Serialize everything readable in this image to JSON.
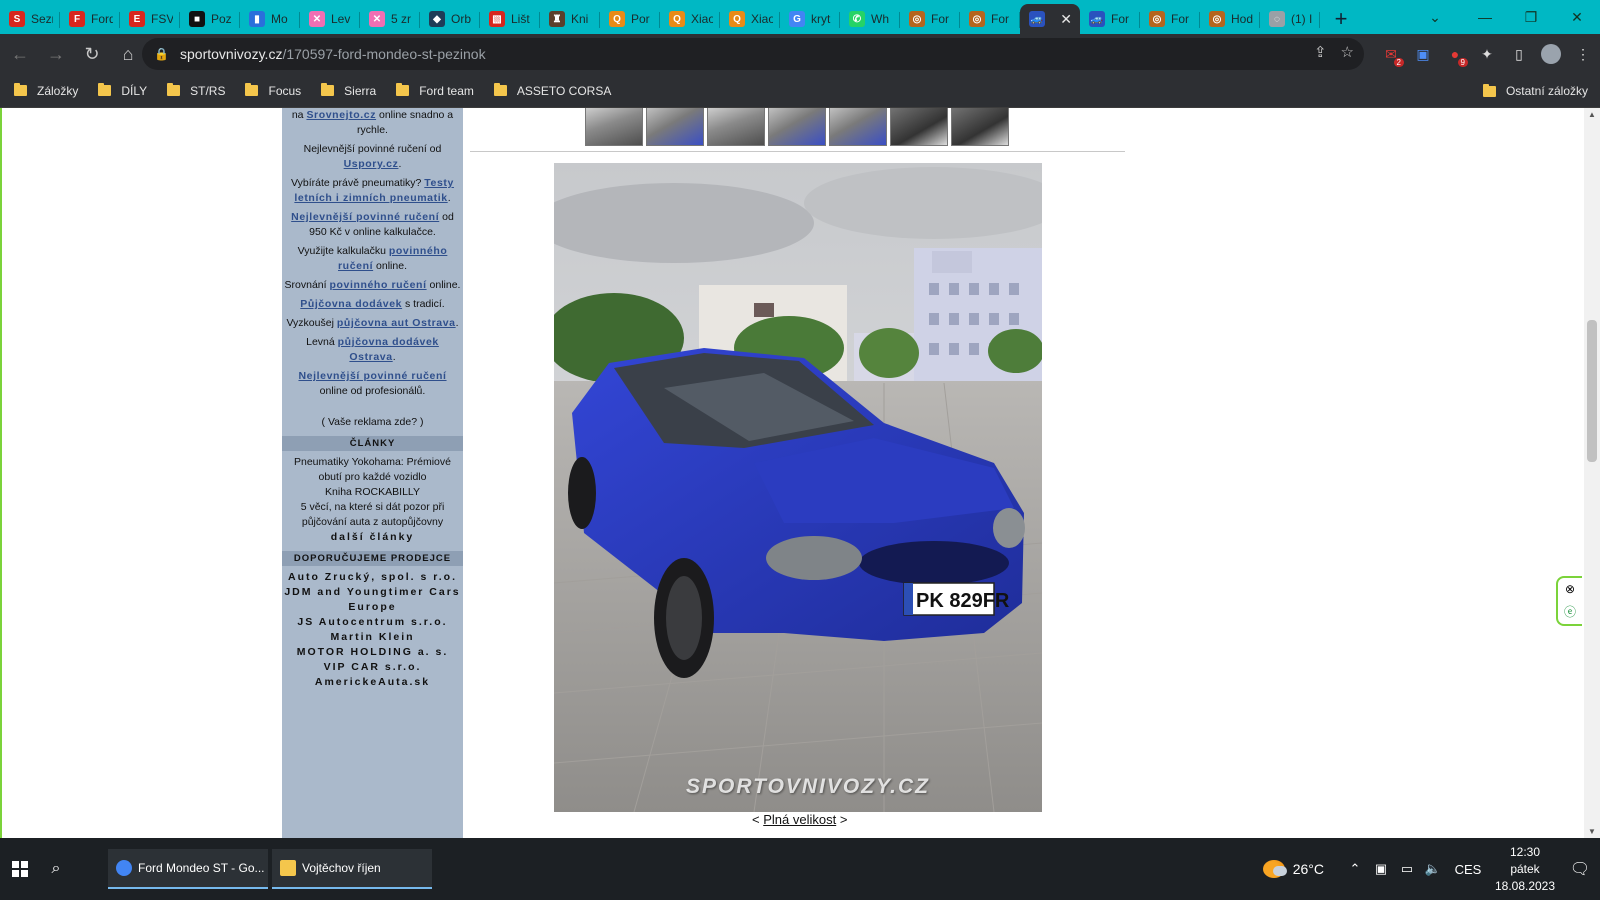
{
  "browser": {
    "tabs": [
      {
        "title": "Sezr",
        "icon": "seznam-icon",
        "color": "#d7261e",
        "glyph": "S"
      },
      {
        "title": "Ford",
        "icon": "ford-forum-icon",
        "color": "#d7261e",
        "glyph": "F"
      },
      {
        "title": "FSV",
        "icon": "fsv-icon",
        "color": "#d7261e",
        "glyph": "E"
      },
      {
        "title": "Poz",
        "icon": "poz-icon",
        "color": "#111111",
        "glyph": "■"
      },
      {
        "title": "Mo",
        "icon": "mo-icon",
        "color": "#2a6fdb",
        "glyph": "▮"
      },
      {
        "title": "Lev",
        "icon": "lev-icon",
        "color": "#f06fb3",
        "glyph": "✕"
      },
      {
        "title": "5 zr",
        "icon": "5zr-icon",
        "color": "#f06fb3",
        "glyph": "✕"
      },
      {
        "title": "Orb",
        "icon": "orb-icon",
        "color": "#1f3d57",
        "glyph": "◆"
      },
      {
        "title": "Lišt",
        "icon": "list-icon",
        "color": "#d7261e",
        "glyph": "▧"
      },
      {
        "title": "Kni",
        "icon": "kniha-icon",
        "color": "#5b3f2b",
        "glyph": "♜"
      },
      {
        "title": "Por",
        "icon": "search-tab-icon",
        "color": "#e88b16",
        "glyph": "Q"
      },
      {
        "title": "Xiao",
        "icon": "search-tab-icon",
        "color": "#e88b16",
        "glyph": "Q"
      },
      {
        "title": "Xiao",
        "icon": "search-tab-icon",
        "color": "#e88b16",
        "glyph": "Q"
      },
      {
        "title": "kryt",
        "icon": "google-icon",
        "color": "#4285f4",
        "glyph": "G"
      },
      {
        "title": "Wh",
        "icon": "whatsapp-icon",
        "color": "#25d366",
        "glyph": "✆"
      },
      {
        "title": "For",
        "icon": "ford-club-icon",
        "color": "#b5651d",
        "glyph": "◎"
      },
      {
        "title": "For",
        "icon": "ford-club-icon",
        "color": "#b5651d",
        "glyph": "◎"
      },
      {
        "title": "",
        "icon": "sportovnivozy-icon",
        "color": "#2a52be",
        "glyph": "🚙",
        "active": true
      },
      {
        "title": "For",
        "icon": "sportovnivozy-icon",
        "color": "#2a52be",
        "glyph": "🚙"
      },
      {
        "title": "For",
        "icon": "ford-club-icon",
        "color": "#b5651d",
        "glyph": "◎"
      },
      {
        "title": "Hod",
        "icon": "ford-club-icon",
        "color": "#b5651d",
        "glyph": "◎"
      },
      {
        "title": "(1) I",
        "icon": "loading-icon",
        "color": "#9aa0a6",
        "glyph": "◌"
      }
    ],
    "new_tab_label": "+",
    "url_host": "sportovnivozy.cz",
    "url_path": "/170597-ford-mondeo-st-pezinok",
    "extension_badges": {
      "mail": "2",
      "ublock": "9"
    },
    "bookmarks": [
      "Záložky",
      "DÍLY",
      "ST/RS",
      "Focus",
      "Sierra",
      "Ford team",
      "ASSETO CORSA"
    ],
    "other_bookmarks": "Ostatní záložky"
  },
  "sidebar": {
    "ads": [
      {
        "pre": "na ",
        "link": "Srovnejto.cz",
        "post": " online snadno a rychle."
      },
      {
        "pre": "Nejlevnější povinné ručení od ",
        "link": "Uspory.cz",
        "post": "."
      },
      {
        "pre": "Vybíráte právě pneumatiky? ",
        "link": "Testy letních i zimních pneumatik",
        "post": "."
      },
      {
        "pre": "",
        "link": "Nejlevnější povinné ručení",
        "post": " od 950 Kč v online kalkulačce."
      },
      {
        "pre": "Využijte kalkulačku ",
        "link": "povinného ručení",
        "post": " online."
      },
      {
        "pre": "Srovnání ",
        "link": "povinného ručení",
        "post": " online."
      },
      {
        "pre": "",
        "link": "Půjčovna dodávek",
        "post": " s tradicí."
      },
      {
        "pre": "Vyzkoušej ",
        "link": "půjčovna aut Ostrava",
        "post": "."
      },
      {
        "pre": "Levná ",
        "link": "půjčovna dodávek Ostrava",
        "post": "."
      },
      {
        "pre": "",
        "link": "Nejlevnější povinné ručení",
        "post": " online od profesionálů."
      }
    ],
    "ad_cta": "( Vaše reklama zde? )",
    "articles_heading": "ČLÁNKY",
    "articles": [
      "Pneumatiky Yokohama: Prémiové obutí pro každé vozidlo",
      "Kniha ROCKABILLY",
      "5 věcí, na které si dát pozor při půjčování auta z autopůjčovny"
    ],
    "more_articles": "další články",
    "dealers_heading": "DOPORUČUJEME PRODEJCE",
    "dealers": [
      "Auto Zrucký, spol. s r.o.",
      "JDM and Youngtimer Cars Europe",
      "JS Autocentrum s.r.o.",
      "Martin Klein",
      "MOTOR HOLDING a. s.",
      "VIP CAR s.r.o.",
      "AmerickeAuta.sk"
    ]
  },
  "gallery": {
    "thumb_count": 7,
    "plate": "PK 829FR",
    "watermark": "SPORTOVNIVOZY.CZ",
    "fullsize_prefix": "< ",
    "fullsize_link": "Plná velikost",
    "fullsize_suffix": " >"
  },
  "taskbar": {
    "tasks": [
      {
        "label": "Ford Mondeo ST - Go...",
        "icon": "chrome-icon",
        "color": "#4285f4"
      },
      {
        "label": "Vojtěchov říjen",
        "icon": "folder-icon",
        "color": "#f4c64c"
      }
    ],
    "weather": "26°C",
    "lang": "CES",
    "time": "12:30",
    "day": "pátek",
    "date": "18.08.2023"
  },
  "colors": {
    "tab_strip": "#00b8c4",
    "toolbar": "#2d2f33",
    "sidebar": "#aab9cb",
    "link": "#2f4f8c",
    "car_blue": "#2a3fc7"
  }
}
